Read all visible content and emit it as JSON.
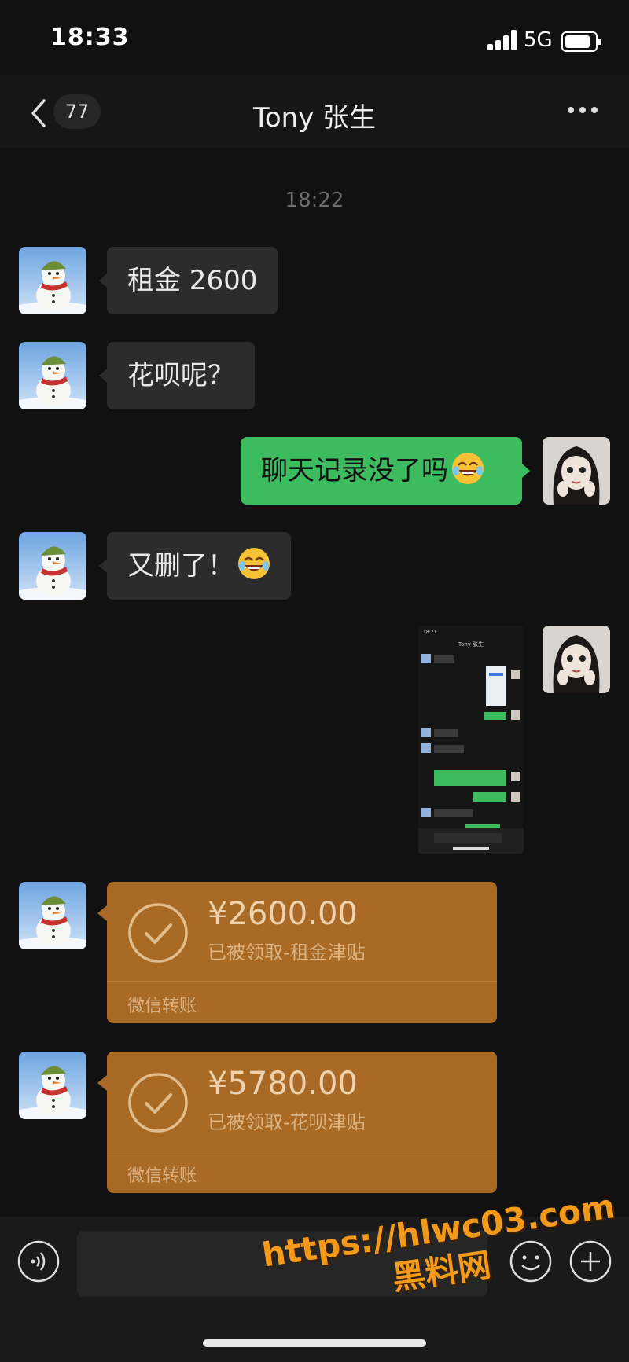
{
  "status_bar": {
    "time": "18:33",
    "network": "5G"
  },
  "header": {
    "back_badge": "77",
    "title": "Tony 张生"
  },
  "chat": {
    "timestamp": "18:22",
    "messages": [
      {
        "side": "in",
        "text": "租金 2600"
      },
      {
        "side": "in",
        "text": "花呗呢？"
      },
      {
        "side": "out",
        "text": "聊天记录没了吗",
        "emoji": "tears-of-joy"
      },
      {
        "side": "in",
        "text": "又删了！",
        "emoji": "tears-of-joy"
      },
      {
        "side": "out",
        "type": "image",
        "thumbnail_header_title": "Tony 张生",
        "thumbnail_time": "18:21"
      },
      {
        "side": "in",
        "type": "transfer",
        "amount": "¥2600.00",
        "note": "已被领取-租金津贴",
        "brand": "微信转账"
      },
      {
        "side": "in",
        "type": "transfer",
        "amount": "¥5780.00",
        "note": "已被领取-花呗津贴",
        "brand": "微信转账"
      }
    ]
  },
  "watermark": {
    "line1": "https://hlwc03.com",
    "line2": "黑料网"
  },
  "colors": {
    "outgoing_bubble": "#3dbb5f",
    "incoming_bubble": "#2c2c2c",
    "transfer_card": "#a86a24",
    "background": "#111111"
  }
}
